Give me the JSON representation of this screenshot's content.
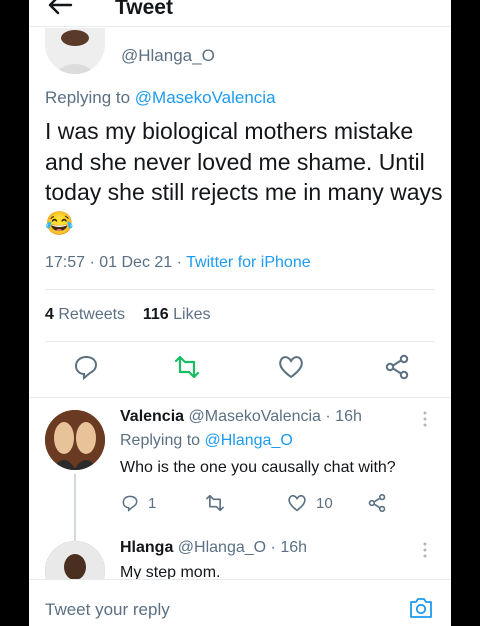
{
  "header": {
    "title": "Tweet"
  },
  "tweet": {
    "handle": "@Hlanga_O",
    "replying_prefix": "Replying to",
    "replying_to": "@MasekoValencia",
    "text": "I was my biological mothers mistake and she never loved me shame. Until today she still rejects me in many ways",
    "emoji": "😂",
    "time": "17:57 · 01 Dec 21 · ",
    "source": "Twitter for iPhone",
    "retweets_count": "4",
    "retweets_label": "Retweets",
    "likes_count": "116",
    "likes_label": "Likes"
  },
  "replies": [
    {
      "name": "Valencia",
      "handle": "@MasekoValencia",
      "time": "· 16h",
      "replying_prefix": "Replying to",
      "replying_to": "@Hlanga_O",
      "text": "Who is the one you causally chat with?",
      "reply_count": "1",
      "like_count": "10"
    },
    {
      "name": "Hlanga",
      "handle": "@Hlanga_O",
      "time": "· 16h",
      "text": "My step mom."
    }
  ],
  "composer": {
    "placeholder": "Tweet your reply"
  },
  "colors": {
    "accent": "#1d9bf0",
    "retweet_green": "#17bf63",
    "text": "#14171a",
    "muted": "#5b7083"
  }
}
